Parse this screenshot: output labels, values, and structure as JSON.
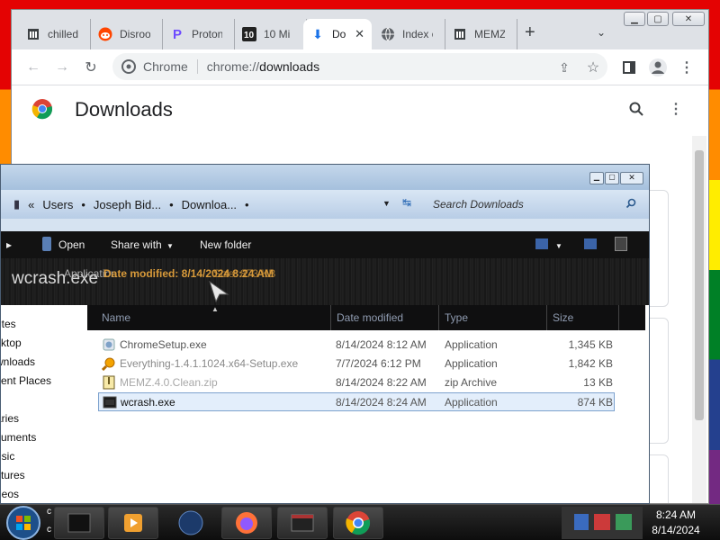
{
  "browser": {
    "tabs": [
      {
        "label": "chilled",
        "icon": "archive-icon"
      },
      {
        "label": "Disroo",
        "icon": "reddit-icon"
      },
      {
        "label": "Proton",
        "icon": "proton-icon"
      },
      {
        "label": "10 Mi",
        "icon": "ten-icon"
      },
      {
        "label": "Do",
        "icon": "download-icon",
        "active": true
      },
      {
        "label": "Index o",
        "icon": "globe-icon"
      },
      {
        "label": "MEMZ",
        "icon": "archive-icon"
      }
    ],
    "new_tab_label": "+",
    "site_chip": "Chrome",
    "url_scheme": "chrome://",
    "url_path": "downloads",
    "page_title": "Downloads"
  },
  "explorer": {
    "breadcrumb": [
      "Users",
      "Joseph Bid...",
      "Downloa..."
    ],
    "search_placeholder": "Search Downloads",
    "toolbar": {
      "open": "Open",
      "share": "Share with",
      "new_folder": "New folder"
    },
    "details": {
      "name_text": "wcrash.exe",
      "type_text": "Application",
      "modified_text": "Date modified: 8/14/2024 8:24 AM",
      "size_text": "Size: 873 KB"
    },
    "columns": {
      "name": "Name",
      "date": "Date modified",
      "type": "Type",
      "size": "Size"
    },
    "nav_items": [
      "rites",
      "sktop",
      "wnloads",
      "cent Places",
      "aries",
      "cuments",
      "usic",
      "ctures",
      "deos"
    ],
    "files": [
      {
        "name": "ChromeSetup.exe",
        "date": "8/14/2024 8:12 AM",
        "type": "Application",
        "size": "1,345 KB",
        "icon": "installer-icon"
      },
      {
        "name": "Everything-1.4.1.1024.x64-Setup.exe",
        "date": "7/7/2024 6:12 PM",
        "type": "Application",
        "size": "1,842 KB",
        "icon": "magnifier-icon"
      },
      {
        "name": "MEMZ.4.0.Clean.zip",
        "date": "8/14/2024 8:22 AM",
        "type": "zip Archive",
        "size": "13 KB",
        "icon": "zip-icon"
      },
      {
        "name": "wcrash.exe",
        "date": "8/14/2024 8:24 AM",
        "type": "Application",
        "size": "874 KB",
        "icon": "exe-icon",
        "selected": true
      }
    ]
  },
  "taskbar": {
    "time": "8:24 AM",
    "date": "8/14/2024",
    "overflow_left": "c",
    "overflow_left2": "c"
  },
  "colors": {
    "accent": "#1a73e8",
    "header_text": "#d89a3a",
    "selection": "#e3eefb"
  }
}
